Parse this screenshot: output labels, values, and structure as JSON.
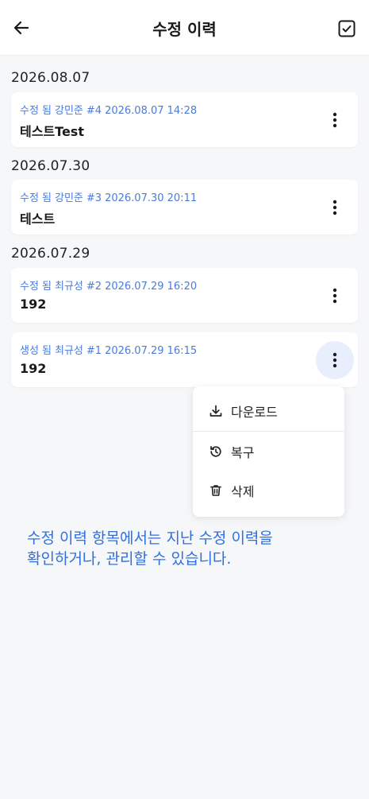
{
  "header": {
    "title": "수정 이력",
    "back_icon": "arrow-left-icon",
    "right_icon": "checkbox-checked-icon"
  },
  "groups": [
    {
      "date": "2026.08.07",
      "entries": [
        {
          "action": "수정 됨",
          "user": "강민준",
          "rev": "#4",
          "timestamp": "2026.08.07 14:28",
          "name": "테스트Test"
        }
      ]
    },
    {
      "date": "2026.07.30",
      "entries": [
        {
          "action": "수정 됨",
          "user": "강민준",
          "rev": "#3",
          "timestamp": "2026.07.30 20:11",
          "name": "테스트"
        }
      ]
    },
    {
      "date": "2026.07.29",
      "entries": [
        {
          "action": "수정 됨",
          "user": "최규성",
          "rev": "#2",
          "timestamp": "2026.07.29 16:20",
          "name": "192"
        },
        {
          "action": "생성 됨",
          "user": "최규성",
          "rev": "#1",
          "timestamp": "2026.07.29 16:15",
          "name": "192"
        }
      ]
    }
  ],
  "menu": {
    "items": [
      {
        "label": "다운로드",
        "icon": "download-icon"
      },
      {
        "label": "복구",
        "icon": "restore-icon"
      },
      {
        "label": "삭제",
        "icon": "trash-icon"
      }
    ]
  },
  "caption": {
    "line1": "수정 이력 항목에서는 지난 수정 이력을",
    "line2": "확인하거나, 관리할 수 있습니다."
  },
  "colors": {
    "accent": "#2f6fe0",
    "meta": "#4a7bdc",
    "background": "#f6f7f9",
    "active_button": "#e8eefb"
  }
}
